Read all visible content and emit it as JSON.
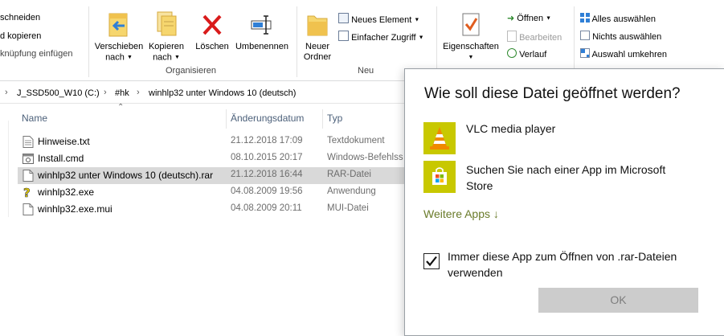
{
  "ribbon": {
    "clipboard": {
      "cut": "schneiden",
      "copy_path": "d kopieren",
      "paste_shortcut": "knüpfung einfügen"
    },
    "organize": {
      "move_to": "Verschieben",
      "move_to_sub": "nach",
      "copy_to": "Kopieren",
      "copy_to_sub": "nach",
      "delete": "Löschen",
      "rename": "Umbenennen",
      "label": "Organisieren"
    },
    "new": {
      "new_folder": "Neuer",
      "new_folder_sub": "Ordner",
      "new_item": "Neues Element",
      "easy_access": "Einfacher Zugriff",
      "label": "Neu"
    },
    "open": {
      "properties": "Eigenschaften",
      "open": "Öffnen",
      "edit": "Bearbeiten",
      "history": "Verlauf"
    },
    "select": {
      "select_all": "Alles auswählen",
      "select_none": "Nichts auswählen",
      "invert": "Auswahl umkehren"
    }
  },
  "address": {
    "crumbs": [
      "J_SSD500_W10 (C:)",
      "#hk",
      "winhlp32 unter Windows 10 (deutsch)"
    ]
  },
  "columns": {
    "name": "Name",
    "date": "Änderungsdatum",
    "type": "Typ"
  },
  "files": [
    {
      "name": "Hinweise.txt",
      "date": "21.12.2018 17:09",
      "type": "Textdokument",
      "icon": "text-file-icon"
    },
    {
      "name": "Install.cmd",
      "date": "08.10.2015 20:17",
      "type": "Windows-Befehlss",
      "icon": "cmd-file-icon"
    },
    {
      "name": "winhlp32 unter Windows 10 (deutsch).rar",
      "date": "21.12.2018 16:44",
      "type": "RAR-Datei",
      "icon": "blank-file-icon"
    },
    {
      "name": "winhlp32.exe",
      "date": "04.08.2009 19:56",
      "type": "Anwendung",
      "icon": "help-exe-icon"
    },
    {
      "name": "winhlp32.exe.mui",
      "date": "04.08.2009 20:11",
      "type": "MUI-Datei",
      "icon": "blank-file-icon"
    }
  ],
  "dialog": {
    "title": "Wie soll diese Datei geöffnet werden?",
    "apps": [
      {
        "name": "VLC media player",
        "icon": "vlc-cone-icon"
      },
      {
        "name_line1": "Suchen Sie nach einer App im Microsoft",
        "name_line2": "Store",
        "icon": "store-bag-icon"
      }
    ],
    "more_apps": "Weitere Apps ↓",
    "always_use": "Immer diese App zum Öffnen von .rar-Dateien verwenden",
    "ok": "OK",
    "accent": "#c8c800"
  }
}
